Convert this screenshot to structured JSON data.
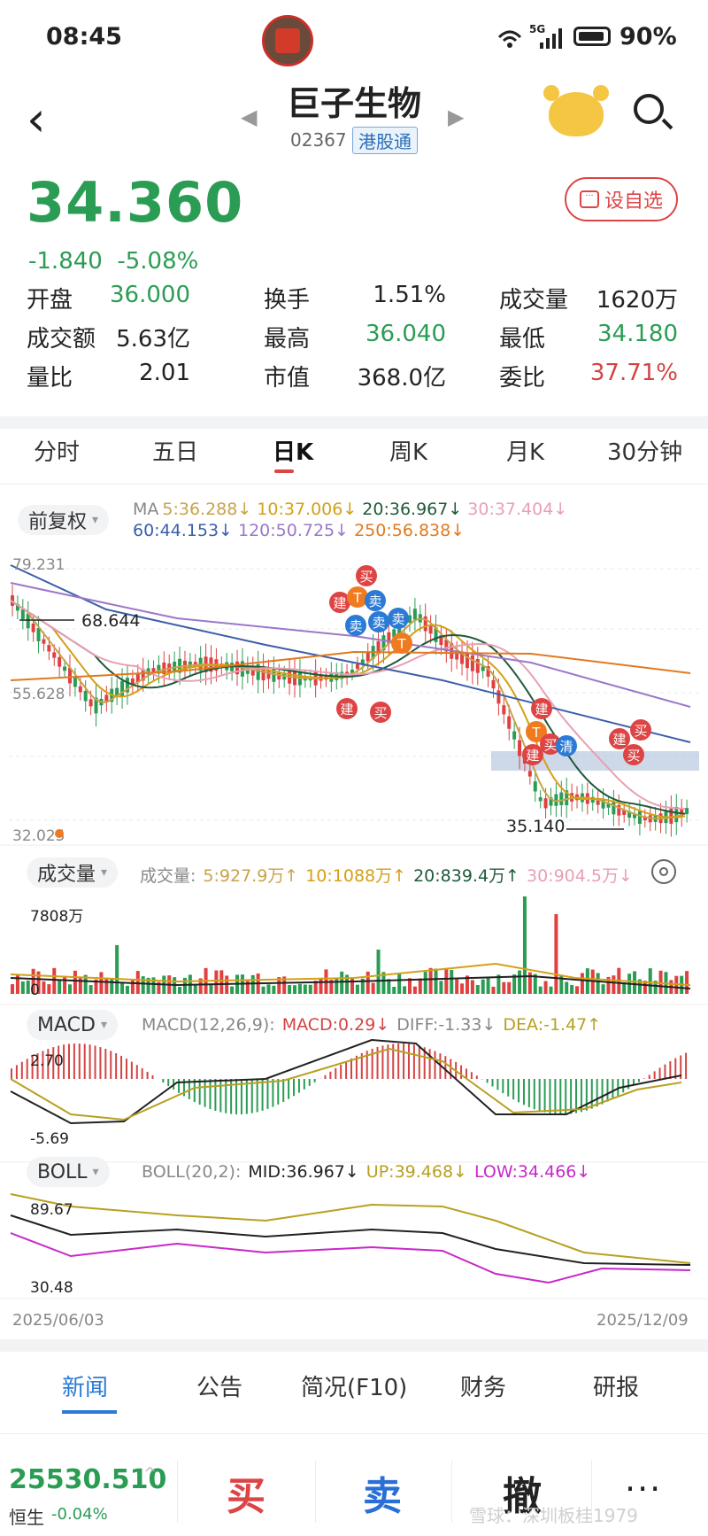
{
  "status": {
    "time": "08:45",
    "network": "5G",
    "battery": "90%"
  },
  "header": {
    "title": "巨子生物",
    "code": "02367",
    "badge": "港股通"
  },
  "quote": {
    "price": "34.360",
    "change": "-1.840",
    "change_pct": "-5.08%",
    "favorite_label": "设自选",
    "stats": [
      {
        "label": "开盘",
        "value": "36.000",
        "color": "#2b9c54"
      },
      {
        "label": "换手",
        "value": "1.51%",
        "color": "#222222"
      },
      {
        "label": "成交量",
        "value": "1620万",
        "color": "#222222"
      },
      {
        "label": "成交额",
        "value": "5.63亿",
        "color": "#222222"
      },
      {
        "label": "最高",
        "value": "36.040",
        "color": "#2b9c54"
      },
      {
        "label": "最低",
        "value": "34.180",
        "color": "#2b9c54"
      },
      {
        "label": "量比",
        "value": "2.01",
        "color": "#222222"
      },
      {
        "label": "市值",
        "value": "368.0亿",
        "color": "#222222"
      },
      {
        "label": "委比",
        "value": "37.71%",
        "color": "#d44444"
      }
    ]
  },
  "period_tabs": [
    "分时",
    "五日",
    "日K",
    "周K",
    "月K",
    "30分钟"
  ],
  "kline": {
    "adjust_label": "前复权",
    "ma_prefix": "MA",
    "ma": [
      {
        "label": "5:36.288↓",
        "color": "#c9a24a"
      },
      {
        "label": "10:37.006↓",
        "color": "#d4a017"
      },
      {
        "label": "20:36.967↓",
        "color": "#1f5a3a"
      },
      {
        "label": "30:37.404↓",
        "color": "#e8a0b4"
      },
      {
        "label": "60:44.153↓",
        "color": "#3b5fa8"
      },
      {
        "label": "120:50.725↓",
        "color": "#9b78c8"
      },
      {
        "label": "250:56.838↓",
        "color": "#e07a20"
      }
    ],
    "axis_high": "79.231",
    "axis_mid": "55.628",
    "axis_low": "32.025",
    "peak_label": "68.644",
    "trough_label": "35.140"
  },
  "volume": {
    "chip_label": "成交量",
    "legend": [
      {
        "label": "成交量:",
        "color": "#888888"
      },
      {
        "label": "5:927.9万↑",
        "color": "#c9a24a"
      },
      {
        "label": "10:1088万↑",
        "color": "#d4a017"
      },
      {
        "label": "20:839.4万↑",
        "color": "#1f5a3a"
      },
      {
        "label": "30:904.5万↓",
        "color": "#e8a0b4"
      }
    ],
    "axis_top": "7808万",
    "axis_zero": "0"
  },
  "macd": {
    "chip_label": "MACD",
    "legend": [
      {
        "label": "MACD(12,26,9):",
        "color": "#888888"
      },
      {
        "label": "MACD:0.29↓",
        "color": "#d44444"
      },
      {
        "label": "DIFF:-1.33↓",
        "color": "#888888"
      },
      {
        "label": "DEA:-1.47↑",
        "color": "#b8a020"
      }
    ],
    "axis_top": "2.70",
    "axis_bottom": "-5.69"
  },
  "boll": {
    "chip_label": "BOLL",
    "legend": [
      {
        "label": "BOLL(20,2):",
        "color": "#888888"
      },
      {
        "label": "MID:36.967↓",
        "color": "#222222"
      },
      {
        "label": "UP:39.468↓",
        "color": "#b8a020"
      },
      {
        "label": "LOW:34.466↓",
        "color": "#c828c8"
      }
    ],
    "axis_top": "89.67",
    "axis_bottom": "30.48",
    "date_start": "2025/06/03",
    "date_end": "2025/12/09"
  },
  "signals": {
    "jian": "建",
    "mai": "买",
    "mai4": "卖",
    "t": "T",
    "qing": "清"
  },
  "bottom_tabs": [
    "新闻",
    "公告",
    "简况(F10)",
    "财务",
    "研报"
  ],
  "index": {
    "value": "25530.510",
    "name": "恒生",
    "pct": "-0.04%"
  },
  "actions": {
    "buy": "买",
    "sell": "卖",
    "cancel": "撤"
  },
  "watermark": "雪球：深圳板桂1979"
}
